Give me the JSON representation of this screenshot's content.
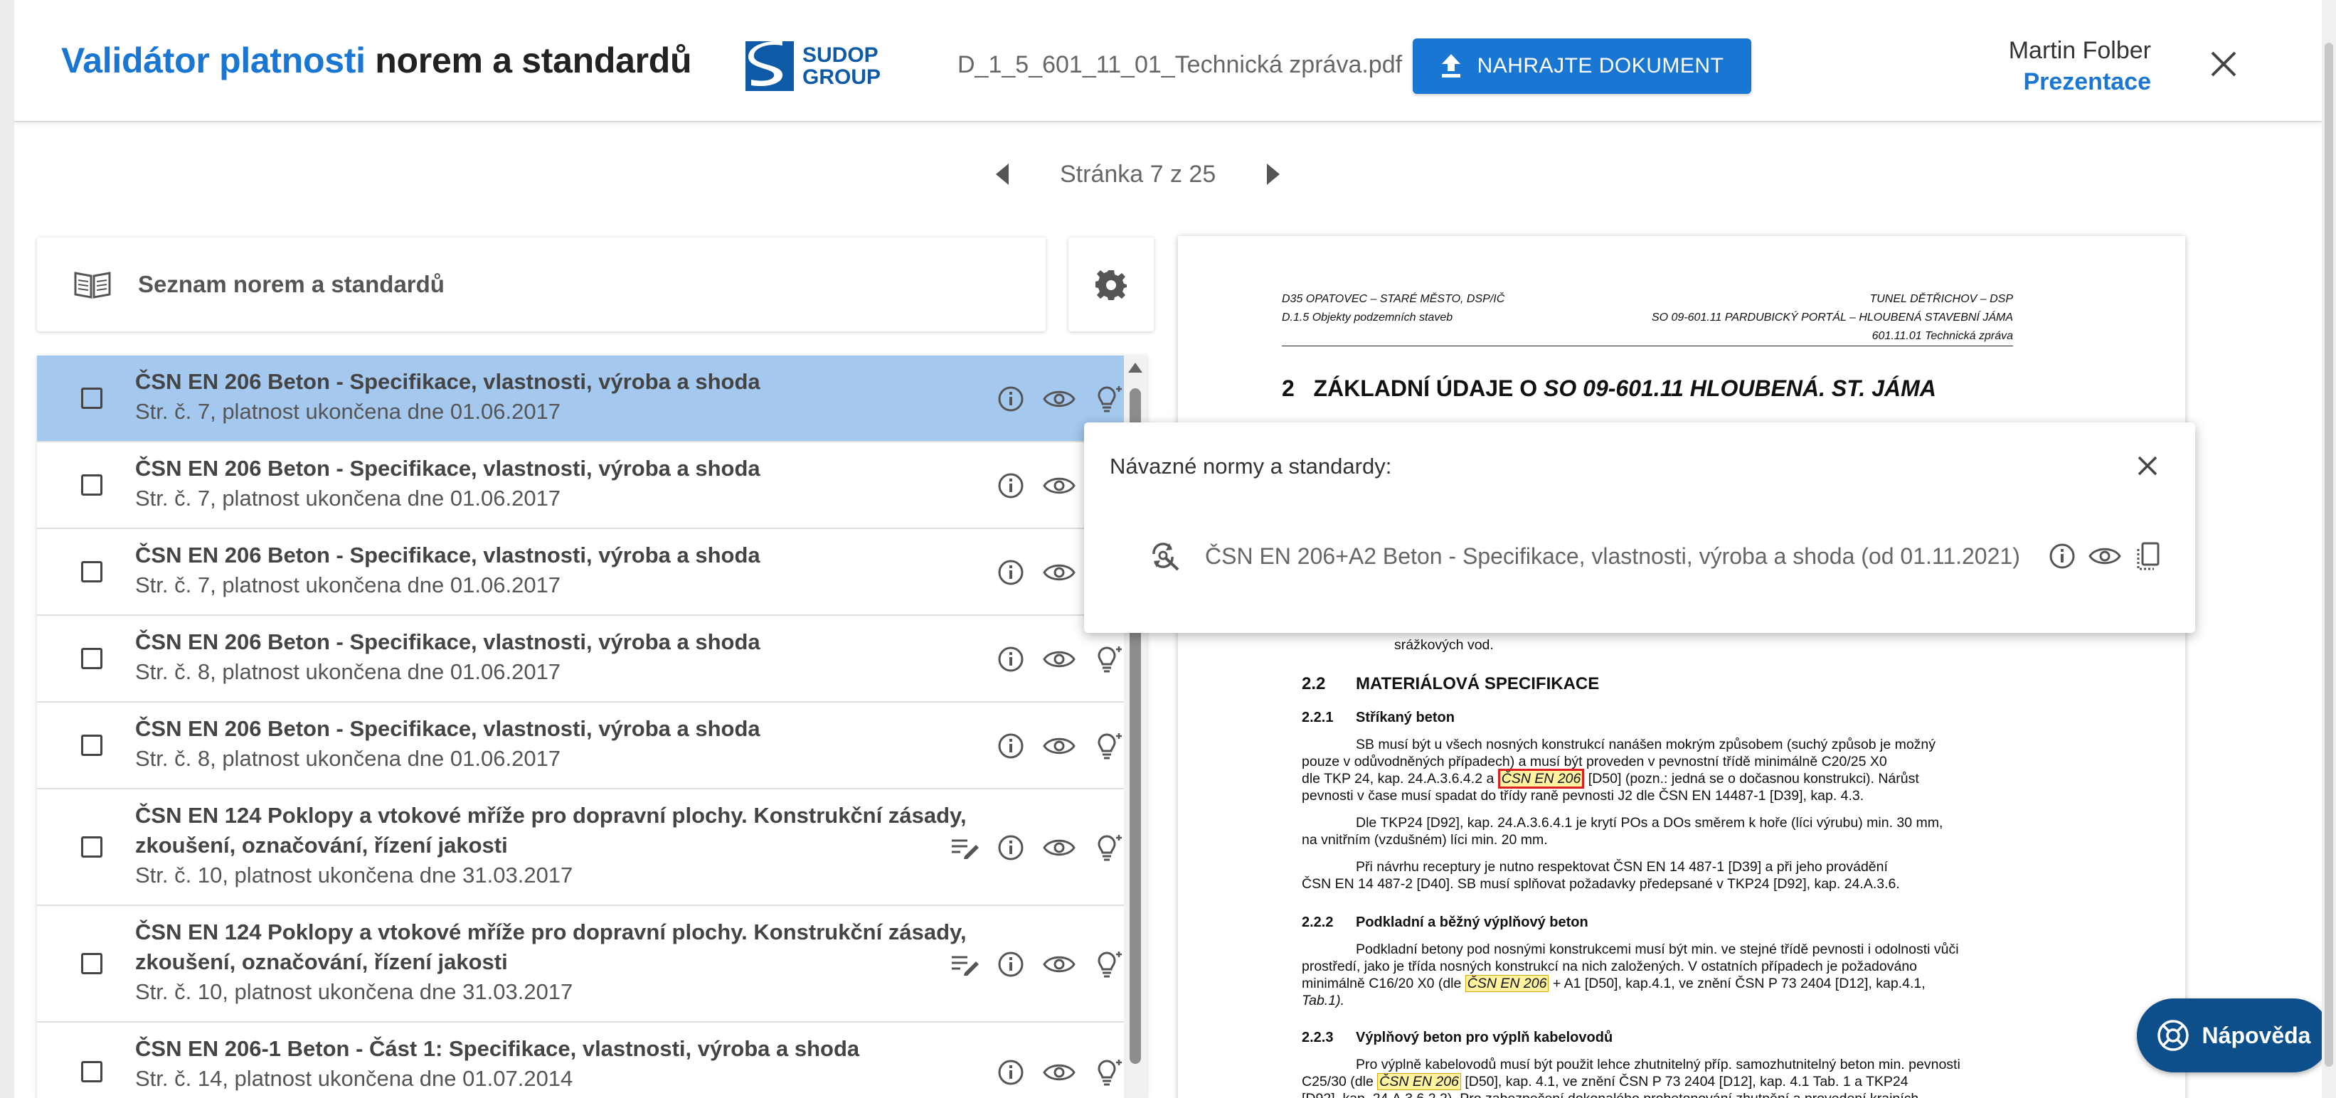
{
  "header": {
    "title_blue": "Validátor platnosti",
    "title_dark": "norem a standardů",
    "logo_line1": "SUDOP",
    "logo_line2": "GROUP",
    "filename": "D_1_5_601_11_01_Technická zpráva.pdf",
    "upload_label": "NAHRAJTE DOKUMENT",
    "user_name": "Martin Folber",
    "user_role": "Prezentace"
  },
  "pager": {
    "text": "Stránka 7 z 25"
  },
  "list": {
    "header": "Seznam norem a standardů",
    "items": [
      {
        "title": "ČSN EN 206 Beton - Specifikace, vlastnosti, výroba a shoda",
        "subtitle": "Str. č. 7, platnost ukončena dne 01.06.2017",
        "selected": true
      },
      {
        "title": "ČSN EN 206 Beton - Specifikace, vlastnosti, výroba a shoda",
        "subtitle": "Str. č. 7, platnost ukončena dne 01.06.2017"
      },
      {
        "title": "ČSN EN 206 Beton - Specifikace, vlastnosti, výroba a shoda",
        "subtitle": "Str. č. 7, platnost ukončena dne 01.06.2017"
      },
      {
        "title": "ČSN EN 206 Beton - Specifikace, vlastnosti, výroba a shoda",
        "subtitle": "Str. č. 8, platnost ukončena dne 01.06.2017"
      },
      {
        "title": "ČSN EN 206 Beton - Specifikace, vlastnosti, výroba a shoda",
        "subtitle": "Str. č. 8, platnost ukončena dne 01.06.2017"
      },
      {
        "title_line1": "ČSN EN 124 Poklopy a vtokové mříže pro dopravní plochy. Konstrukční zásady,",
        "title_line2": "zkoušení, označování, řízení jakosti",
        "subtitle": "Str. č. 10, platnost ukončena dne 31.03.2017"
      },
      {
        "title_line1": "ČSN EN 124 Poklopy a vtokové mříže pro dopravní plochy. Konstrukční zásady,",
        "title_line2": "zkoušení, označování, řízení jakosti",
        "subtitle": "Str. č. 10, platnost ukončena dne 31.03.2017"
      },
      {
        "title": "ČSN EN 206-1 Beton - Část 1: Specifikace, vlastnosti, výroba a shoda",
        "subtitle": "Str. č. 14, platnost ukončena dne 01.07.2014"
      }
    ]
  },
  "popup": {
    "title": "Návazné normy a standardy:",
    "item": "ČSN EN 206+A2 Beton - Specifikace, vlastnosti, výroba a shoda (od 01.11.2021)"
  },
  "doc": {
    "hdr_left1": "D35 OPATOVEC – STARÉ MĚSTO, DSP/IČ",
    "hdr_left2": "D.1.5  Objekty podzemních staveb",
    "hdr_right1": "TUNEL DĚTŘICHOV – DSP",
    "hdr_right2": "SO 09-601.11  PARDUBICKÝ PORTÁL – HLOUBENÁ STAVEBNÍ JÁMA",
    "hdr_right3": "601.11.01  Technická zpráva",
    "h1_num": "2",
    "h1_text": "ZÁKLADNÍ ÚDAJE O",
    "h1_ital": "SO 09-601.11  HLOUBENÁ. ST. JÁMA",
    "frag1": "srážkových vod.",
    "s22_num": "2.2",
    "s22": "MATERIÁLOVÁ SPECIFIKACE",
    "s221_num": "2.2.1",
    "s221": "Stříkaný beton",
    "p1_l1": "SB musí být u všech nosných konstrukcí nanášen mokrým způsobem (suchý způsob je možný",
    "p1_l2": "pouze v odůvodněných případech) a musí být proveden v pevnostní třídě minimálně C20/25 X0",
    "p1_l3a": "dle TKP 24, kap. 24.A.3.6.4.2 a",
    "p1_hl": "ČSN EN 206",
    "p1_l3b": "[D50] (pozn.: jedná se o dočasnou konstrukci). Nárůst",
    "p1_l4": "pevnosti v čase musí spadat do třídy raně pevnosti J2 dle ČSN EN 14487-1 [D39], kap. 4.3.",
    "p2_l1": "Dle TKP24 [D92], kap. 24.A.3.6.4.1 je krytí POs a DOs směrem k hoře (líci výrubu) min. 30 mm,",
    "p2_l2": "na vnitřním (vzdušném) líci min. 20 mm.",
    "p3_l1": "Při návrhu receptury je nutno respektovat ČSN EN 14 487-1 [D39] a při jeho provádění",
    "p3_l2": "ČSN EN 14 487-2 [D40]. SB musí splňovat požadavky předepsané v TKP24 [D92], kap. 24.A.3.6.",
    "s222_num": "2.2.2",
    "s222": "Podkladní a běžný výplňový beton",
    "p4_l1": "Podkladní betony pod nosnými konstrukcemi musí být min. ve stejné třídě pevnosti i odolnosti vůči",
    "p4_l2": "prostředí, jako je třída nosných konstrukcí na nich založených. V ostatních případech je požadováno",
    "p4_l3a": "minimálně C16/20 X0 (dle",
    "p4_hl": "ČSN EN 206",
    "p4_l3b": "+ A1 [D50], kap.4.1, ve znění ČSN P 73 2404 [D12], kap.4.1,",
    "p4_l4": "Tab.1).",
    "s223_num": "2.2.3",
    "s223": "Výplňový beton pro výplň kabelovodů",
    "p5_l1": "Pro výplně kabelovodů musí být použit lehce zhutnitelný příp. samozhutnitelný beton min. pevnosti",
    "p5_l2a": "C25/30 (dle",
    "p5_hl": "ČSN EN 206",
    "p5_l2b": "[D50], kap. 4.1, ve znění ČSN P 73 2404 [D12], kap. 4.1 Tab. 1 a TKP24",
    "p5_l3": "[D92], kap. 24.A.3.6.2.2). Pro zabezpečení dokonalého probetonování zhutnění a provedení krajních"
  },
  "help": {
    "label": "Nápověda"
  },
  "colors": {
    "accent": "#1976d2",
    "selected_row": "#a4c8ee",
    "help": "#0d4f8b",
    "highlight": "#fff3a0",
    "highlight_border_red": "#e02020"
  }
}
